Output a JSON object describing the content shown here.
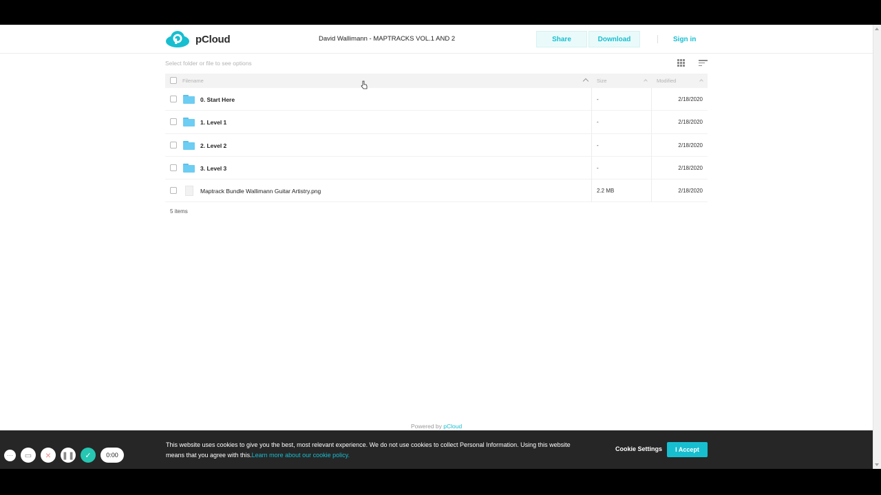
{
  "header": {
    "logo_text": "pCloud",
    "title": "David Wallimann - MAPTRACKS VOL.1 AND 2",
    "share_label": "Share",
    "download_label": "Download",
    "signin_label": "Sign in"
  },
  "toolbar": {
    "hint": "Select folder or file to see options"
  },
  "table": {
    "columns": {
      "filename": "Filename",
      "size": "Size",
      "modified": "Modified"
    },
    "rows": [
      {
        "name": "0. Start Here",
        "type": "folder",
        "size": "-",
        "modified": "2/18/2020"
      },
      {
        "name": "1. Level 1",
        "type": "folder",
        "size": "-",
        "modified": "2/18/2020"
      },
      {
        "name": "2. Level 2",
        "type": "folder",
        "size": "-",
        "modified": "2/18/2020"
      },
      {
        "name": "3. Level 3",
        "type": "folder",
        "size": "-",
        "modified": "2/18/2020"
      },
      {
        "name": "Maptrack Bundle Wallimann Guitar Artistry.png",
        "type": "file",
        "size": "2.2 MB",
        "modified": "2/18/2020"
      }
    ],
    "item_count": "5 items"
  },
  "footer": {
    "powered_prefix": "Powered by",
    "powered_brand": "pCloud"
  },
  "cookie_banner": {
    "text": "This website uses cookies to give you the best, most relevant experience. We do not use cookies to collect Personal Information. Using this website means that you agree with this.",
    "link": "Learn more about our cookie policy.",
    "settings_label": "Cookie Settings",
    "accept_label": "I Accept"
  },
  "recorder": {
    "time": "0:00"
  },
  "colors": {
    "accent": "#17bed0",
    "folder": "#6dcdf2",
    "banner_bg": "#262626"
  }
}
